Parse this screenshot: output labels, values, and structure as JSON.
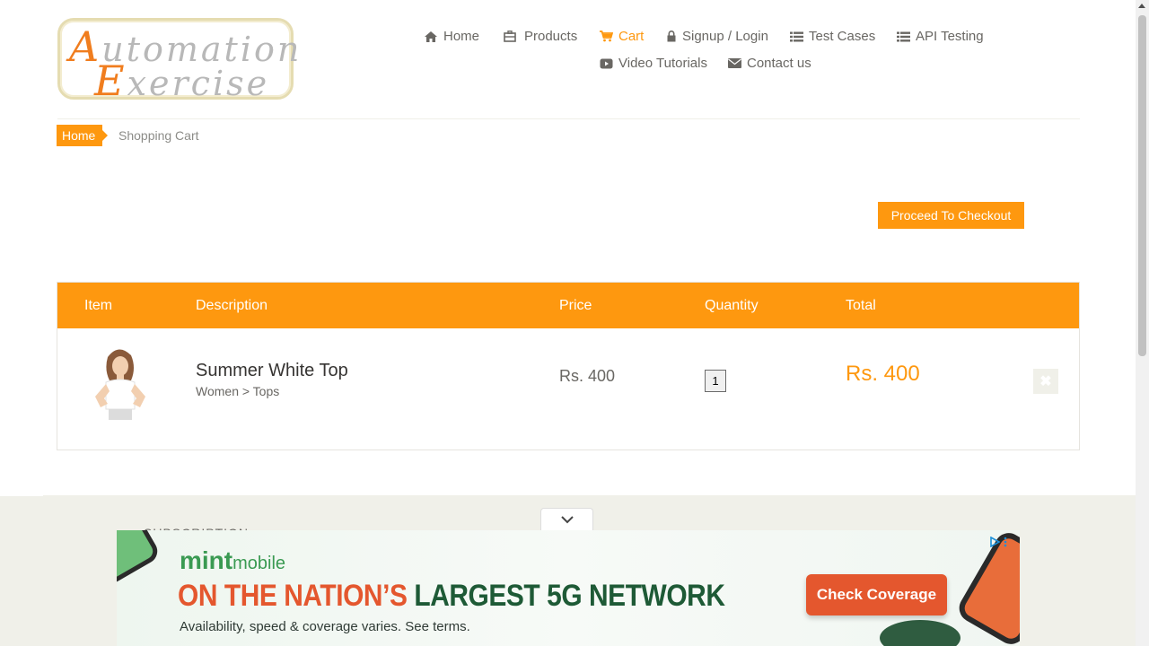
{
  "logo": {
    "line1_cap": "A",
    "line1_rest": "utomation",
    "line2_cap": "E",
    "line2_rest": "xercise"
  },
  "nav": {
    "items": [
      {
        "label": "Home",
        "icon": "home-icon"
      },
      {
        "label": "Products",
        "icon": "products-icon"
      },
      {
        "label": "Cart",
        "icon": "cart-icon",
        "active": true
      },
      {
        "label": "Signup / Login",
        "icon": "lock-icon"
      },
      {
        "label": "Test Cases",
        "icon": "list-icon"
      },
      {
        "label": "API Testing",
        "icon": "list-icon"
      },
      {
        "label": "Video Tutorials",
        "icon": "youtube-icon"
      },
      {
        "label": "Contact us",
        "icon": "envelope-icon"
      }
    ]
  },
  "breadcrumb": {
    "home": "Home",
    "current": "Shopping Cart"
  },
  "checkout_button": "Proceed To Checkout",
  "cart": {
    "headers": [
      "Item",
      "Description",
      "Price",
      "Quantity",
      "Total"
    ],
    "rows": [
      {
        "name": "Summer White Top",
        "category": "Women > Tops",
        "price": "Rs. 400",
        "quantity": "1",
        "total": "Rs. 400"
      }
    ]
  },
  "footer": {
    "subscription": "SUBSCRIPTION"
  },
  "ad": {
    "brand_mint": "mint",
    "brand_mobile": "mobile",
    "headline_red": "ON THE NATION’S",
    "headline_green": "LARGEST 5G NETWORK",
    "subtext": "Availability, speed & coverage varies. See terms.",
    "cta": "Check Coverage"
  },
  "colors": {
    "accent": "#fe980f",
    "text": "#696763",
    "ad_red": "#e4572e",
    "ad_green": "#1e5a36"
  }
}
